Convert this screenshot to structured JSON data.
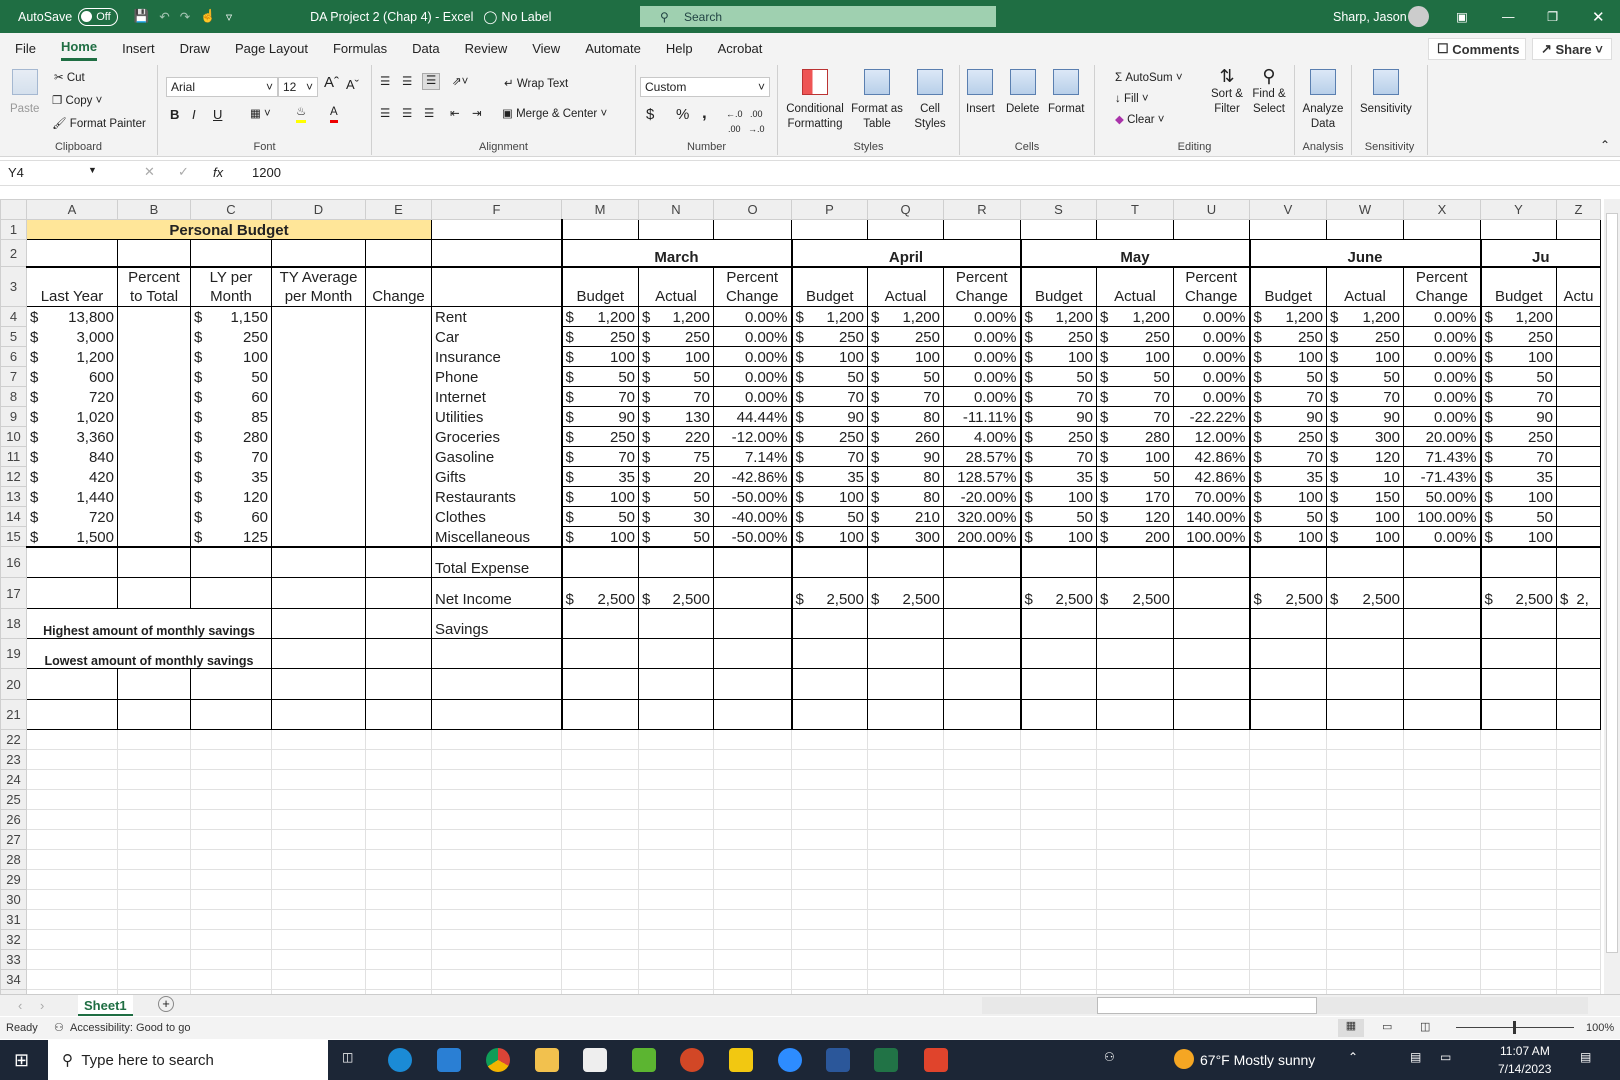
{
  "titlebar": {
    "autosave": "AutoSave",
    "autosave_state": "Off",
    "doc_title": "DA Project 2 (Chap 4)  -  Excel",
    "label": "No Label",
    "search_placeholder": "Search",
    "user": "Sharp, Jason"
  },
  "tabs": [
    "File",
    "Home",
    "Insert",
    "Draw",
    "Page Layout",
    "Formulas",
    "Data",
    "Review",
    "View",
    "Automate",
    "Help",
    "Acrobat"
  ],
  "comments": "Comments",
  "share": "Share",
  "ribbon": {
    "clipboard": {
      "paste": "Paste",
      "cut": "Cut",
      "copy": "Copy",
      "format_painter": "Format Painter",
      "label": "Clipboard"
    },
    "font": {
      "name": "Arial",
      "size": "12",
      "bold": "B",
      "italic": "I",
      "underline": "U",
      "label": "Font"
    },
    "alignment": {
      "wrap": "Wrap Text",
      "merge": "Merge & Center",
      "label": "Alignment"
    },
    "number": {
      "format": "Custom",
      "currency": "$",
      "percent": "%",
      "comma": ",",
      "label": "Number"
    },
    "styles": {
      "conditional": "Conditional Formatting",
      "format_table": "Format as Table",
      "cell_styles": "Cell Styles",
      "label": "Styles"
    },
    "cells": {
      "insert": "Insert",
      "delete": "Delete",
      "format": "Format",
      "label": "Cells"
    },
    "editing": {
      "autosum": "AutoSum",
      "fill": "Fill",
      "clear": "Clear",
      "sort": "Sort & Filter",
      "find": "Find & Select",
      "label": "Editing"
    },
    "analysis": {
      "analyze": "Analyze Data",
      "label": "Analysis"
    },
    "sensitivity": {
      "btn": "Sensitivity",
      "label": "Sensitivity"
    }
  },
  "formula_bar": {
    "name_box": "Y4",
    "fx": "fx",
    "value": "1200"
  },
  "columns": [
    "A",
    "B",
    "C",
    "D",
    "E",
    "F",
    "M",
    "N",
    "O",
    "P",
    "Q",
    "R",
    "S",
    "T",
    "U",
    "V",
    "W",
    "X",
    "Y",
    "Z"
  ],
  "rows": {
    "1": {
      "A": "Personal Budget"
    },
    "2": {
      "M": "March",
      "P": "April",
      "S": "May",
      "V": "June",
      "Y": "Ju"
    },
    "3": {
      "A": "Last Year",
      "B": "Percent to Total",
      "C": "LY per Month",
      "D": "TY Average per Month",
      "E": "Change",
      "M": "Budget",
      "N": "Actual",
      "O": "Percent Change",
      "P": "Budget",
      "Q": "Actual",
      "R": "Percent Change",
      "S": "Budget",
      "T": "Actual",
      "U": "Percent Change",
      "V": "Budget",
      "W": "Actual",
      "X": "Percent Change",
      "Y": "Budget",
      "Z": "Actu"
    },
    "4": {
      "A": "$ 13,800",
      "C": "$ 1,150",
      "F": "Rent",
      "M": "$ 1,200",
      "N": "$ 1,200",
      "O": "0.00%",
      "P": "$ 1,200",
      "Q": "$ 1,200",
      "R": "0.00%",
      "S": "$ 1,200",
      "T": "$ 1,200",
      "U": "0.00%",
      "V": "$ 1,200",
      "W": "$ 1,200",
      "X": "0.00%",
      "Y": "$ 1,200"
    },
    "5": {
      "A": "$ 3,000",
      "C": "$ 250",
      "F": "Car",
      "M": "$ 250",
      "N": "$ 250",
      "O": "0.00%",
      "P": "$ 250",
      "Q": "$ 250",
      "R": "0.00%",
      "S": "$ 250",
      "T": "$ 250",
      "U": "0.00%",
      "V": "$ 250",
      "W": "$ 250",
      "X": "0.00%",
      "Y": "$ 250"
    },
    "6": {
      "A": "$ 1,200",
      "C": "$ 100",
      "F": "Insurance",
      "M": "$ 100",
      "N": "$ 100",
      "O": "0.00%",
      "P": "$ 100",
      "Q": "$ 100",
      "R": "0.00%",
      "S": "$ 100",
      "T": "$ 100",
      "U": "0.00%",
      "V": "$ 100",
      "W": "$ 100",
      "X": "0.00%",
      "Y": "$ 100"
    },
    "7": {
      "A": "$ 600",
      "C": "$ 50",
      "F": "Phone",
      "M": "$ 50",
      "N": "$ 50",
      "O": "0.00%",
      "P": "$ 50",
      "Q": "$ 50",
      "R": "0.00%",
      "S": "$ 50",
      "T": "$ 50",
      "U": "0.00%",
      "V": "$ 50",
      "W": "$ 50",
      "X": "0.00%",
      "Y": "$ 50"
    },
    "8": {
      "A": "$ 720",
      "C": "$ 60",
      "F": "Internet",
      "M": "$ 70",
      "N": "$ 70",
      "O": "0.00%",
      "P": "$ 70",
      "Q": "$ 70",
      "R": "0.00%",
      "S": "$ 70",
      "T": "$ 70",
      "U": "0.00%",
      "V": "$ 70",
      "W": "$ 70",
      "X": "0.00%",
      "Y": "$ 70"
    },
    "9": {
      "A": "$ 1,020",
      "C": "$ 85",
      "F": "Utilities",
      "M": "$ 90",
      "N": "$ 130",
      "O": "44.44%",
      "P": "$ 90",
      "Q": "$ 80",
      "R": "-11.11%",
      "S": "$ 90",
      "T": "$ 70",
      "U": "-22.22%",
      "V": "$ 90",
      "W": "$ 90",
      "X": "0.00%",
      "Y": "$ 90"
    },
    "10": {
      "A": "$ 3,360",
      "C": "$ 280",
      "F": "Groceries",
      "M": "$ 250",
      "N": "$ 220",
      "O": "-12.00%",
      "P": "$ 250",
      "Q": "$ 260",
      "R": "4.00%",
      "S": "$ 250",
      "T": "$ 280",
      "U": "12.00%",
      "V": "$ 250",
      "W": "$ 300",
      "X": "20.00%",
      "Y": "$ 250"
    },
    "11": {
      "A": "$ 840",
      "C": "$ 70",
      "F": "Gasoline",
      "M": "$ 70",
      "N": "$ 75",
      "O": "7.14%",
      "P": "$ 70",
      "Q": "$ 90",
      "R": "28.57%",
      "S": "$ 70",
      "T": "$ 100",
      "U": "42.86%",
      "V": "$ 70",
      "W": "$ 120",
      "X": "71.43%",
      "Y": "$ 70"
    },
    "12": {
      "A": "$ 420",
      "C": "$ 35",
      "F": "Gifts",
      "M": "$ 35",
      "N": "$ 20",
      "O": "-42.86%",
      "P": "$ 35",
      "Q": "$ 80",
      "R": "128.57%",
      "S": "$ 35",
      "T": "$ 50",
      "U": "42.86%",
      "V": "$ 35",
      "W": "$ 10",
      "X": "-71.43%",
      "Y": "$ 35"
    },
    "13": {
      "A": "$ 1,440",
      "C": "$ 120",
      "F": "Restaurants",
      "M": "$ 100",
      "N": "$ 50",
      "O": "-50.00%",
      "P": "$ 100",
      "Q": "$ 80",
      "R": "-20.00%",
      "S": "$ 100",
      "T": "$ 170",
      "U": "70.00%",
      "V": "$ 100",
      "W": "$ 150",
      "X": "50.00%",
      "Y": "$ 100"
    },
    "14": {
      "A": "$ 720",
      "C": "$ 60",
      "F": "Clothes",
      "M": "$ 50",
      "N": "$ 30",
      "O": "-40.00%",
      "P": "$ 50",
      "Q": "$ 210",
      "R": "320.00%",
      "S": "$ 50",
      "T": "$ 120",
      "U": "140.00%",
      "V": "$ 50",
      "W": "$ 100",
      "X": "100.00%",
      "Y": "$ 50"
    },
    "15": {
      "A": "$ 1,500",
      "C": "$ 125",
      "F": "Miscellaneous",
      "M": "$ 100",
      "N": "$ 50",
      "O": "-50.00%",
      "P": "$ 100",
      "Q": "$ 300",
      "R": "200.00%",
      "S": "$ 100",
      "T": "$ 200",
      "U": "100.00%",
      "V": "$ 100",
      "W": "$ 100",
      "X": "0.00%",
      "Y": "$ 100"
    },
    "16": {
      "F": "Total Expense"
    },
    "17": {
      "F": "Net Income",
      "M": "$ 2,500",
      "N": "$ 2,500",
      "P": "$ 2,500",
      "Q": "$ 2,500",
      "S": "$ 2,500",
      "T": "$ 2,500",
      "V": "$ 2,500",
      "W": "$ 2,500",
      "Y": "$ 2,500",
      "Z": "$ 2,"
    },
    "18": {
      "A": "Highest amount of monthly savings",
      "F": "Savings"
    },
    "19": {
      "A": "Lowest amount of monthly savings"
    }
  },
  "sheet_tabs": [
    "Sheet1"
  ],
  "status": {
    "ready": "Ready",
    "accessibility": "Accessibility: Good to go",
    "zoom": "100%"
  },
  "taskbar": {
    "search_placeholder": "Type here to search",
    "weather": "67°F  Mostly sunny",
    "time": "11:07 AM",
    "date": "7/14/2023"
  },
  "colors": {
    "title_green": "#1f6e43",
    "header_yellow": "#ffe699"
  }
}
